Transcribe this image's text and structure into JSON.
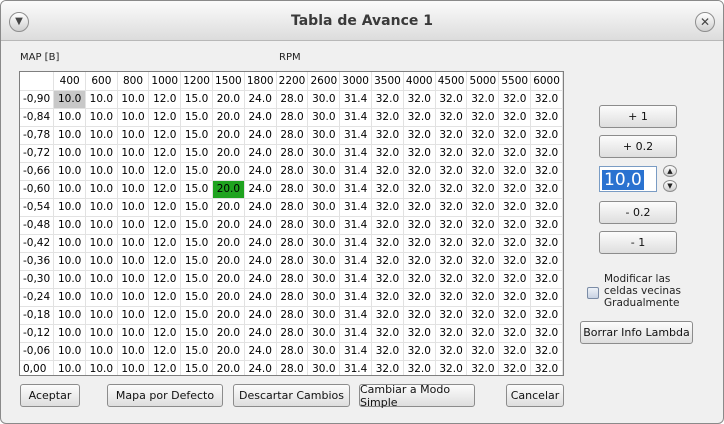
{
  "window": {
    "title": "Tabla de Avance 1",
    "menu_icon": "chevron-down-icon",
    "close_icon": "close-icon"
  },
  "labels": {
    "map": "MAP [B]",
    "rpm": "RPM"
  },
  "table": {
    "columns": [
      "400",
      "600",
      "800",
      "1000",
      "1200",
      "1500",
      "1800",
      "2200",
      "2600",
      "3000",
      "3500",
      "4000",
      "4500",
      "5000",
      "5500",
      "6000"
    ],
    "rows": [
      "-0,90",
      "-0,84",
      "-0,78",
      "-0,72",
      "-0,66",
      "-0,60",
      "-0,54",
      "-0,48",
      "-0,42",
      "-0,36",
      "-0,30",
      "-0,24",
      "-0,18",
      "-0,12",
      "-0,06",
      "0,00"
    ],
    "row_values": [
      "10.0",
      "10.0",
      "10.0",
      "12.0",
      "15.0",
      "20.0",
      "24.0",
      "28.0",
      "30.0",
      "31.4",
      "32.0",
      "32.0",
      "32.0",
      "32.0",
      "32.0",
      "32.0"
    ],
    "selected_cell_gray": {
      "row": 0,
      "col": 0
    },
    "selected_cell_green": {
      "row": 5,
      "col": 5
    },
    "colors": {
      "green": "#1fa31f",
      "gray": "#c8c8c8"
    }
  },
  "side_panel": {
    "plus1": "+ 1",
    "plus02": "+ 0.2",
    "spin_value": "10,0",
    "minus02": "- 0.2",
    "minus1": "- 1",
    "checkbox_label_line1": "Modificar las",
    "checkbox_label_line2": "celdas vecinas",
    "checkbox_label_line3": "Gradualmente",
    "checkbox_checked": false,
    "clear_lambda": "Borrar Info Lambda"
  },
  "footer": {
    "accept": "Aceptar",
    "default_map": "Mapa por Defecto",
    "discard": "Descartar Cambios",
    "simple_mode": "Cambiar a Modo Simple",
    "cancel": "Cancelar"
  }
}
